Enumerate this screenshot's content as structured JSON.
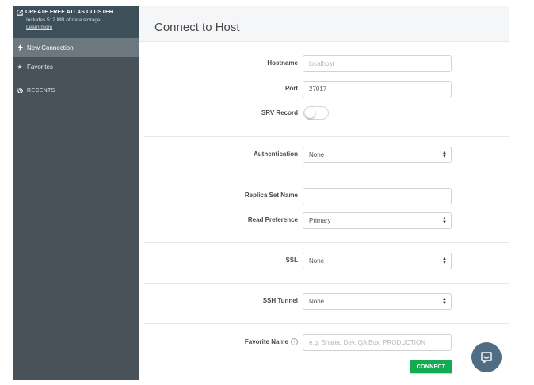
{
  "sidebar": {
    "atlas": {
      "title": "CREATE FREE ATLAS CLUSTER",
      "subtitle": "Includes 512 MB of data storage.",
      "link": "Learn more"
    },
    "items": [
      {
        "label": "New Connection",
        "icon": "lightning-icon"
      },
      {
        "label": "Favorites",
        "icon": "star-icon"
      }
    ],
    "recents_label": "RECENTS"
  },
  "header": {
    "title": "Connect to Host"
  },
  "form": {
    "hostname": {
      "label": "Hostname",
      "placeholder": "localhost"
    },
    "port": {
      "label": "Port",
      "value": "27017"
    },
    "srv": {
      "label": "SRV Record",
      "on": false
    },
    "authentication": {
      "label": "Authentication",
      "value": "None"
    },
    "replica_set": {
      "label": "Replica Set Name",
      "value": ""
    },
    "read_preference": {
      "label": "Read Preference",
      "value": "Primary"
    },
    "ssl": {
      "label": "SSL",
      "value": "None"
    },
    "ssh_tunnel": {
      "label": "SSH Tunnel",
      "value": "None"
    },
    "favorite_name": {
      "label": "Favorite Name",
      "placeholder": "e.g. Shared Dev, QA Box, PRODUCTION"
    }
  },
  "connect_label": "CONNECT",
  "colors": {
    "sidebar": "#4a5259",
    "accent": "#13aa52",
    "chat": "#4f6e85"
  }
}
